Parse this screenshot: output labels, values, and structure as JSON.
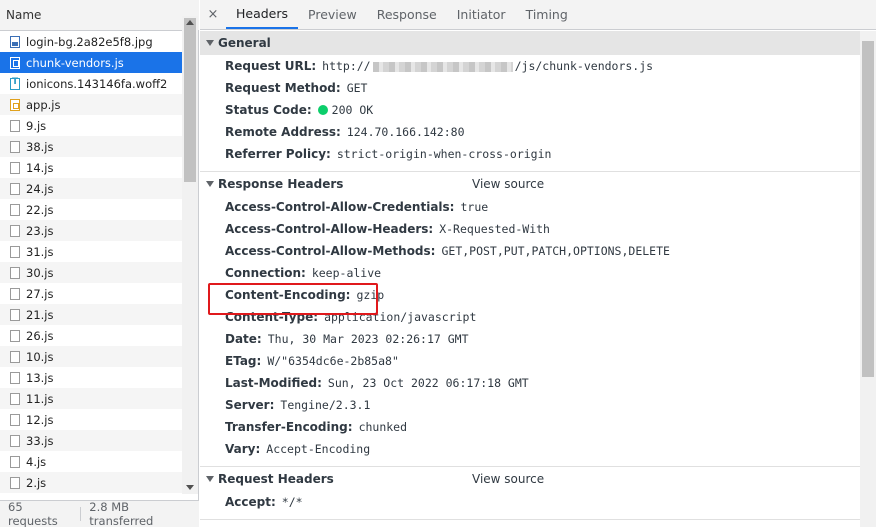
{
  "request_list": {
    "header": "Name",
    "items": [
      {
        "name": "login-bg.2a82e5f8.jpg",
        "icon": "image-file-icon",
        "selected": false
      },
      {
        "name": "chunk-vendors.js",
        "icon": "script-file-icon",
        "selected": true
      },
      {
        "name": "ionicons.143146fa.woff2",
        "icon": "font-file-icon",
        "selected": false
      },
      {
        "name": "app.js",
        "icon": "js-file-icon",
        "selected": false
      },
      {
        "name": "9.js",
        "icon": "document-file-icon",
        "selected": false
      },
      {
        "name": "38.js",
        "icon": "document-file-icon",
        "selected": false
      },
      {
        "name": "14.js",
        "icon": "document-file-icon",
        "selected": false
      },
      {
        "name": "24.js",
        "icon": "document-file-icon",
        "selected": false
      },
      {
        "name": "22.js",
        "icon": "document-file-icon",
        "selected": false
      },
      {
        "name": "23.js",
        "icon": "document-file-icon",
        "selected": false
      },
      {
        "name": "31.js",
        "icon": "document-file-icon",
        "selected": false
      },
      {
        "name": "30.js",
        "icon": "document-file-icon",
        "selected": false
      },
      {
        "name": "27.js",
        "icon": "document-file-icon",
        "selected": false
      },
      {
        "name": "21.js",
        "icon": "document-file-icon",
        "selected": false
      },
      {
        "name": "26.js",
        "icon": "document-file-icon",
        "selected": false
      },
      {
        "name": "10.js",
        "icon": "document-file-icon",
        "selected": false
      },
      {
        "name": "13.js",
        "icon": "document-file-icon",
        "selected": false
      },
      {
        "name": "11.js",
        "icon": "document-file-icon",
        "selected": false
      },
      {
        "name": "12.js",
        "icon": "document-file-icon",
        "selected": false
      },
      {
        "name": "33.js",
        "icon": "document-file-icon",
        "selected": false
      },
      {
        "name": "4.js",
        "icon": "document-file-icon",
        "selected": false
      },
      {
        "name": "2.js",
        "icon": "document-file-icon",
        "selected": false
      }
    ],
    "status": {
      "requests": "65 requests",
      "transferred": "2.8 MB transferred"
    }
  },
  "tabs": {
    "close": "×",
    "items": [
      "Headers",
      "Preview",
      "Response",
      "Initiator",
      "Timing"
    ],
    "active": "Headers"
  },
  "general": {
    "title": "General",
    "request_url_key": "Request URL:",
    "request_url_prefix": "http://",
    "request_url_suffix": "/js/chunk-vendors.js",
    "request_method_key": "Request Method:",
    "request_method_val": "GET",
    "status_code_key": "Status Code:",
    "status_code_val": "200 OK",
    "status_color": "#0cce6b",
    "remote_address_key": "Remote Address:",
    "remote_address_val": "124.70.166.142:80",
    "referrer_policy_key": "Referrer Policy:",
    "referrer_policy_val": "strict-origin-when-cross-origin"
  },
  "response_headers": {
    "title": "Response Headers",
    "view_source": "View source",
    "items": [
      {
        "key": "Access-Control-Allow-Credentials:",
        "value": "true"
      },
      {
        "key": "Access-Control-Allow-Headers:",
        "value": "X-Requested-With"
      },
      {
        "key": "Access-Control-Allow-Methods:",
        "value": "GET,POST,PUT,PATCH,OPTIONS,DELETE"
      },
      {
        "key": "Connection:",
        "value": "keep-alive"
      },
      {
        "key": "Content-Encoding:",
        "value": "gzip"
      },
      {
        "key": "Content-Type:",
        "value": "application/javascript"
      },
      {
        "key": "Date:",
        "value": "Thu, 30 Mar 2023 02:26:17 GMT"
      },
      {
        "key": "ETag:",
        "value": "W/\"6354dc6e-2b85a8\""
      },
      {
        "key": "Last-Modified:",
        "value": "Sun, 23 Oct 2022 06:17:18 GMT"
      },
      {
        "key": "Server:",
        "value": "Tengine/2.3.1"
      },
      {
        "key": "Transfer-Encoding:",
        "value": "chunked"
      },
      {
        "key": "Vary:",
        "value": "Accept-Encoding"
      }
    ]
  },
  "request_headers": {
    "title": "Request Headers",
    "view_source": "View source",
    "items": [
      {
        "key": "Accept:",
        "value": "*/*"
      }
    ]
  },
  "colors": {
    "selected_row": "#1a73e8",
    "highlight_box": "#e0191c",
    "active_tab_underline": "#1a73e8"
  }
}
